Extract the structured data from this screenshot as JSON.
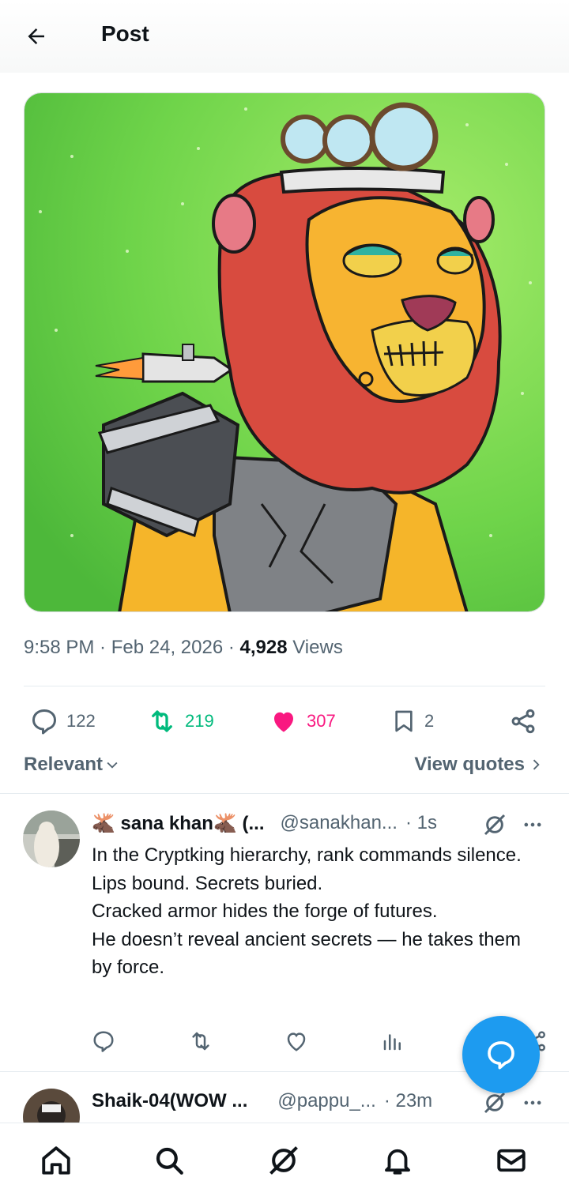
{
  "header": {
    "title": "Post"
  },
  "post": {
    "time": "9:58 PM",
    "date": "Feb 24, 2026",
    "views_count": "4,928",
    "views_label": "Views",
    "stats": {
      "replies": "122",
      "reposts": "219",
      "likes": "307",
      "bookmarks": "2"
    }
  },
  "filters": {
    "sort_label": "Relevant",
    "view_quotes_label": "View quotes"
  },
  "replies": [
    {
      "name": "🫎 sana khan🫎 (...",
      "handle": "@sanakhan...",
      "time": "· 1s",
      "lines": [
        "In the Cryptking hierarchy, rank commands silence.",
        "Lips bound. Secrets buried.",
        "Cracked armor hides the forge of futures.",
        "He doesn’t reveal ancient secrets — he takes them by force."
      ]
    },
    {
      "name": "Shaik-04(WOW ...",
      "handle": "@pappu_...",
      "time": "· 23m"
    }
  ],
  "colors": {
    "accent": "#1d9bf0",
    "repost": "#00ba7c",
    "like": "#f91880",
    "secondary_text": "#536471",
    "media_green": "#6fd44a"
  },
  "icons": {
    "back": "arrow-left-icon",
    "reply": "speech-bubble-icon",
    "repost": "repost-icon",
    "like": "heart-icon",
    "bookmark": "bookmark-icon",
    "share": "share-icon",
    "grok": "grok-icon",
    "more": "more-icon",
    "nav": [
      "home-icon",
      "search-icon",
      "grok-icon",
      "bell-icon",
      "mail-icon"
    ]
  }
}
